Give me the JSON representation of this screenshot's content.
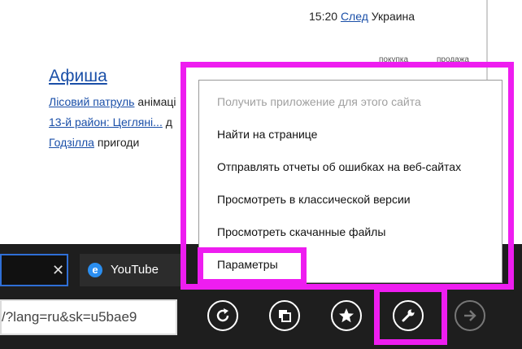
{
  "page": {
    "news_time": "15:20",
    "news_link": "След",
    "news_rest": " Украина",
    "afisha_title": "Афиша",
    "col_headers": [
      "покупка",
      "продажа"
    ],
    "movies": [
      {
        "title": "Лісовий патруль",
        "genre": " анімаці"
      },
      {
        "title": "13-й район: Цегляні...",
        "genre": " д"
      },
      {
        "title": "Годзілла",
        "genre": " пригоди"
      }
    ]
  },
  "tabs": [
    {
      "label": "",
      "active": true
    },
    {
      "label": "YouTube",
      "active": false
    }
  ],
  "address": {
    "value": "/?lang=ru&sk=u5bae9"
  },
  "menu": {
    "items": [
      {
        "label": "Получить приложение для этого сайта",
        "disabled": true
      },
      {
        "label": "Найти на странице",
        "disabled": false
      },
      {
        "label": "Отправлять отчеты об ошибках на веб-сайтах",
        "disabled": false
      },
      {
        "label": "Просмотреть в классической версии",
        "disabled": false
      },
      {
        "label": "Просмотреть скачанные файлы",
        "disabled": false
      },
      {
        "label": "Параметры",
        "disabled": false
      }
    ]
  },
  "icons": [
    "refresh-icon",
    "tabs-icon",
    "favorites-icon",
    "tools-wrench-icon",
    "forward-icon",
    "close-icon",
    "ie-icon"
  ],
  "colors": {
    "highlight": "#ee1df0",
    "link": "#1a4fa8",
    "appbar": "#1e1e1e"
  }
}
